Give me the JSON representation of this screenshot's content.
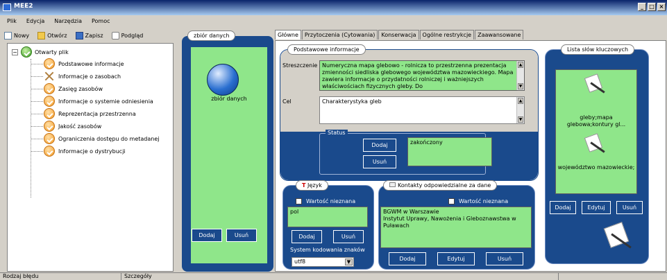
{
  "window": {
    "title": "MEE2",
    "controls": [
      "_",
      "□",
      "×"
    ]
  },
  "menu": [
    "Plik",
    "Edycja",
    "Narzędzia",
    "Pomoc"
  ],
  "toolbar": {
    "new": "Nowy",
    "open": "Otwórz",
    "save": "Zapisz",
    "preview": "Podgląd"
  },
  "tree": {
    "root": "Otwarty plik",
    "items": [
      "Podstawowe informacje",
      "Informacje o zasobach",
      "Zasięg zasobów",
      "Informacje o systemie odniesienia",
      "Reprezentacja przestrzenna",
      "Jakość zasobów",
      "Ograniczenia dostępu do metadanej",
      "Informacje o dystrybucji"
    ]
  },
  "dataset_panel": {
    "title": "zbiór danych",
    "item_label": "zbiór danych",
    "add": "Dodaj",
    "remove": "Usuń"
  },
  "tabs": [
    "Główne",
    "Przytoczenia (Cytowania)",
    "Konserwacja",
    "Ogólne restrykcje",
    "Zaawansowane"
  ],
  "basic": {
    "title": "Podstawowe informacje",
    "abstract_label": "Streszczenie",
    "abstract": "Numeryczna mapa glebowo - rolnicza to przestrzenna prezentacja zmienności siedliska glebowego województwa mazowieckiego. Mapa zawiera informacje o przydatności rolniczej i ważniejszych właściwościach fizycznych gleby. Do",
    "purpose_label": "Cel",
    "purpose": "Charakterystyka gleb",
    "status_label": "Status",
    "status_add": "Dodaj",
    "status_remove": "Usuń",
    "status_value": "zakończony"
  },
  "language": {
    "title": "Język",
    "unknown": "Wartość nieznana",
    "value": "pol",
    "add": "Dodaj",
    "remove": "Usuń",
    "encoding_label": "System kodowania znaków",
    "encoding": "utf8"
  },
  "contacts": {
    "title": "Kontakty odpowiedzialne za dane",
    "unknown": "Wartość nieznana",
    "line1": "BGWM w Warszawie",
    "line2": "Instytut Uprawy, Nawożenia i Gleboznawstwa w Puławach",
    "add": "Dodaj",
    "edit": "Edytuj",
    "remove": "Usuń"
  },
  "keywords": {
    "title": "Lista słów kluczowych",
    "kw1": "gleby;mapa glebowa;kontury gl...",
    "kw2": "województwo mazowieckie;",
    "add": "Dodaj",
    "edit": "Edytuj",
    "remove": "Usuń"
  },
  "status": {
    "col1": "Rodzaj błędu",
    "col2": "Szczegóły"
  },
  "colors": {
    "panel_blue": "#1a4a8c",
    "field_green": "#8fe68a"
  }
}
